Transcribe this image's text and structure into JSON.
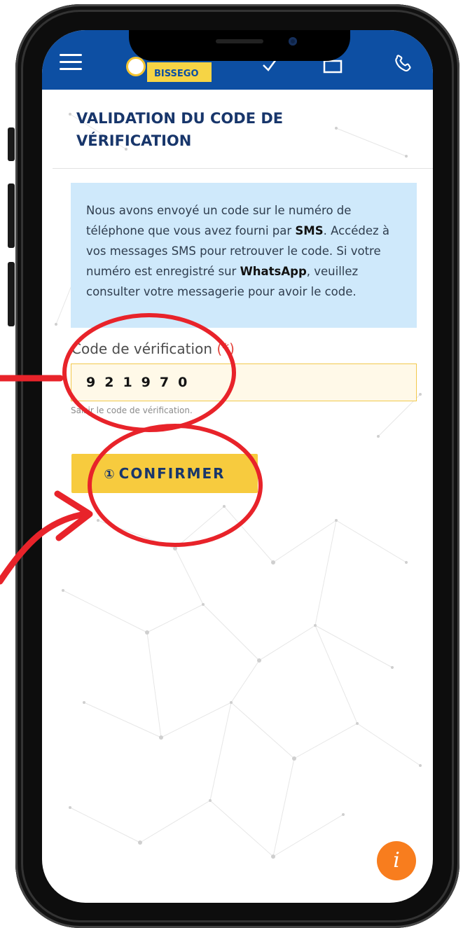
{
  "navbar": {
    "logo_text": "BISSEGO",
    "menu_icon": "hamburger-menu-icon",
    "phone_icon": "phone-icon"
  },
  "page": {
    "title": "VALIDATION DU CODE DE VÉRIFICATION"
  },
  "info": {
    "part1": "Nous avons envoyé un code sur le numéro de téléphone que vous avez fourni par ",
    "sms": "SMS",
    "part2": ". Accédez à vos messages SMS pour retrouver le code. Si votre numéro est enregistré sur ",
    "whatsapp": "WhatsApp",
    "part3": ", veuillez consulter votre messagerie pour avoir le code."
  },
  "form": {
    "label": "Code de vérification",
    "required_marker": "(*)",
    "code_value": "921970",
    "help_text": "Saisir le code de vérification."
  },
  "confirm_button": {
    "label": "CONFIRMER",
    "icon": "confirm-circle-icon"
  },
  "fab": {
    "icon": "info-icon",
    "glyph": "i"
  },
  "colors": {
    "navbar": "#0d4fa3",
    "title": "#18366b",
    "info_bg": "#cfe9fb",
    "accent_yellow": "#f7cb3e",
    "required": "#e4483f",
    "fab": "#f87d1e",
    "annotation_red": "#e8232a"
  }
}
